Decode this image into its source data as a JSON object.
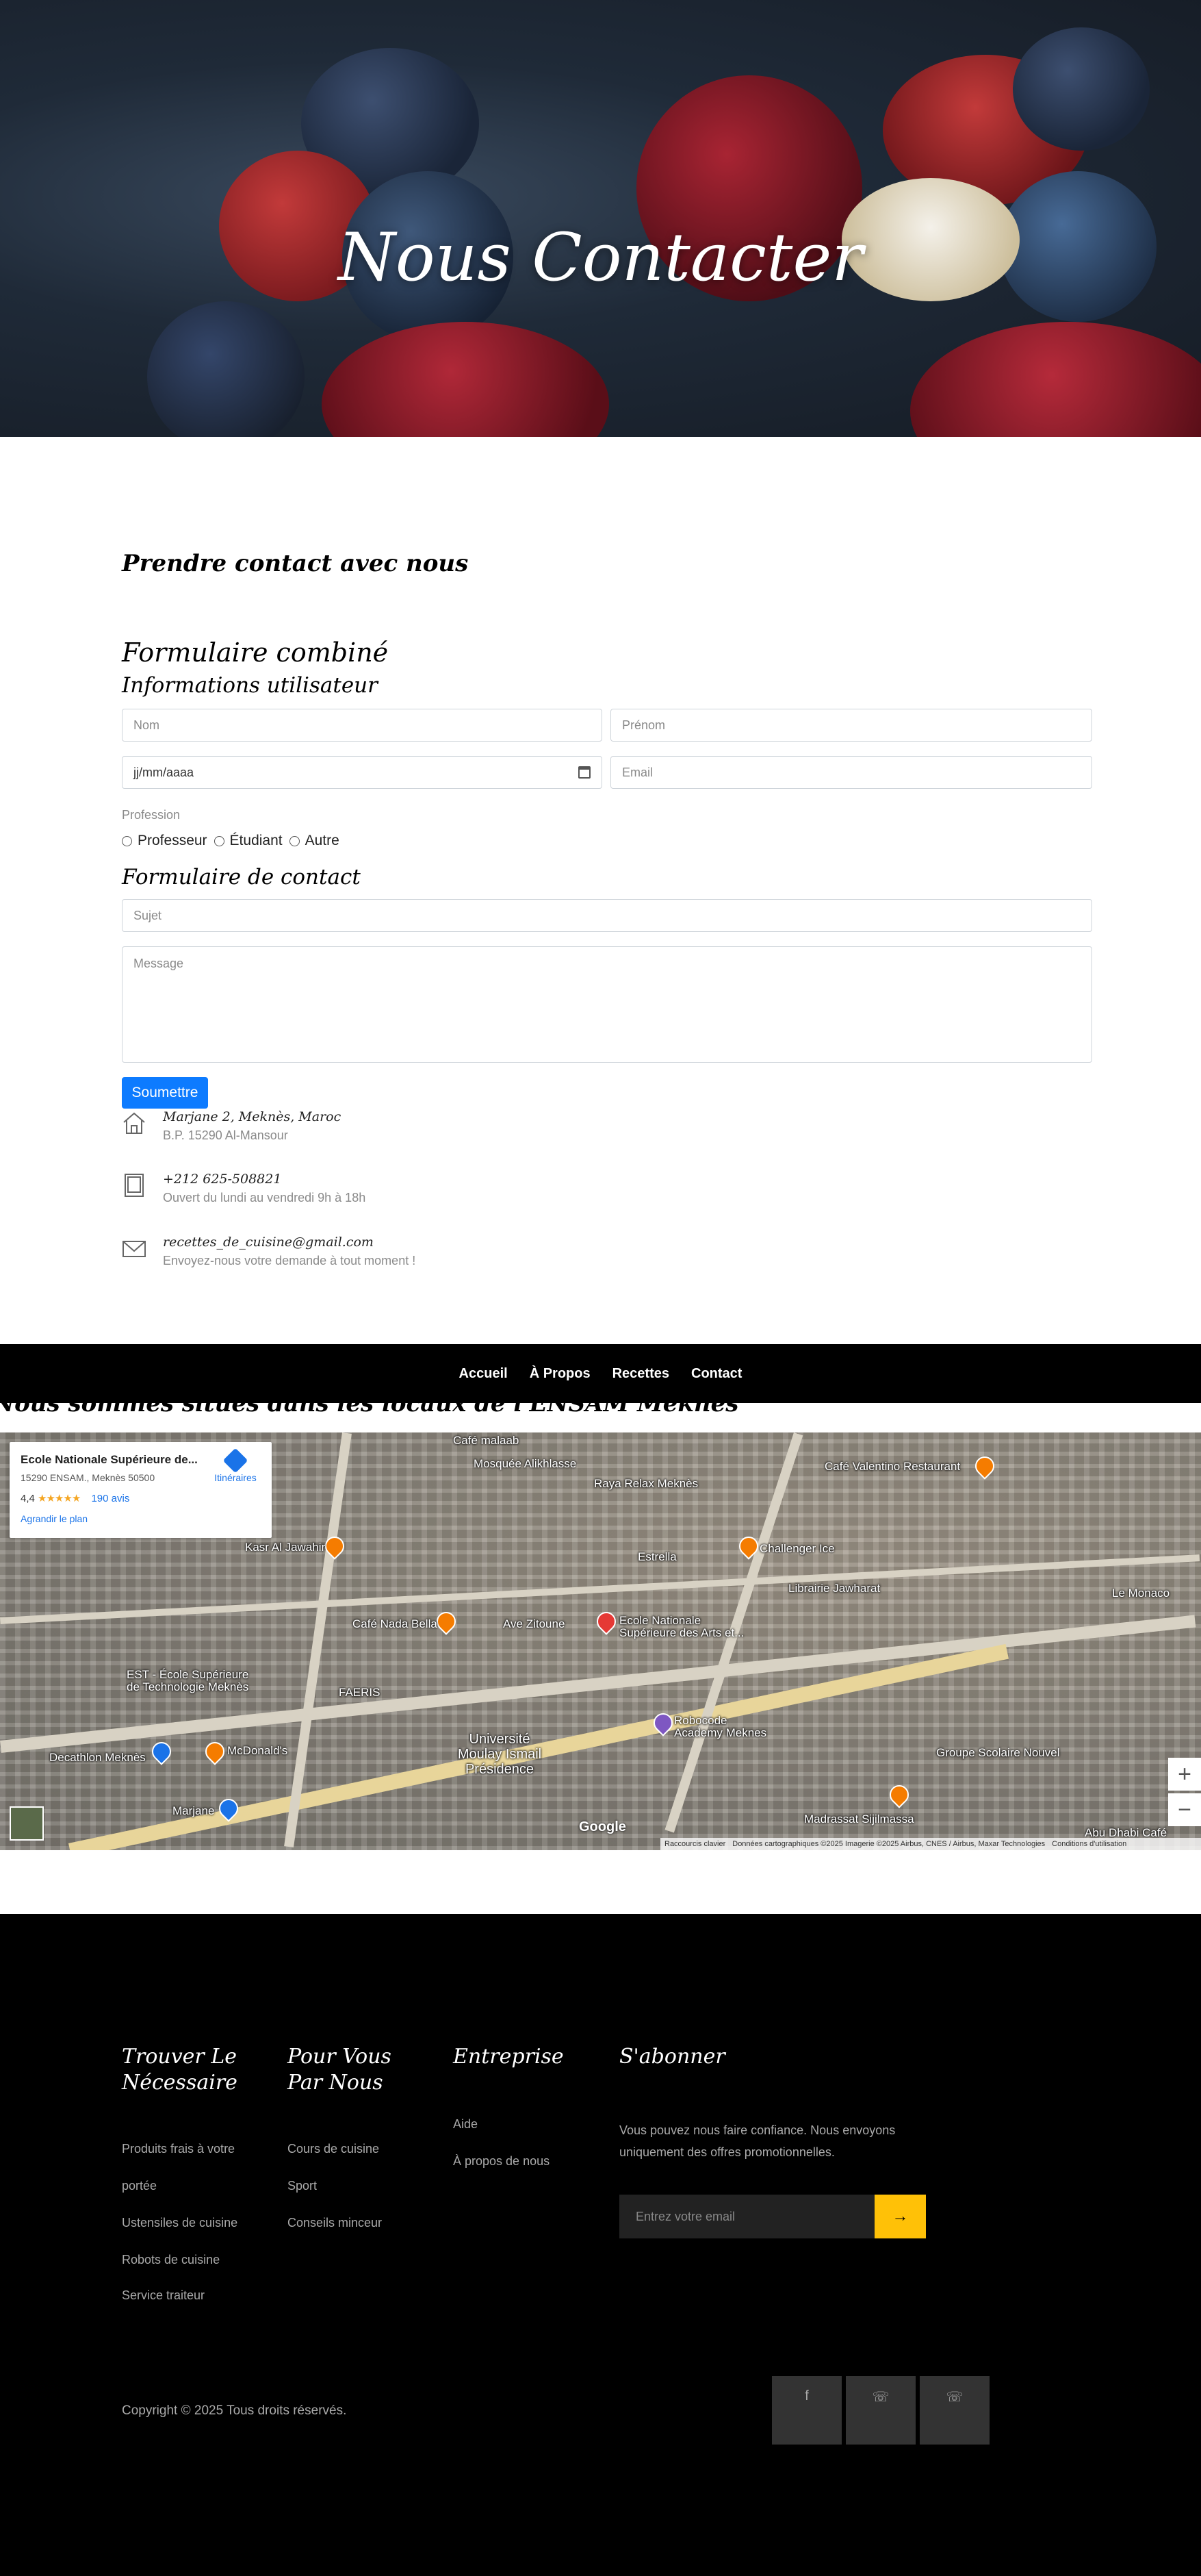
{
  "hero": {
    "title": "Nous Contacter"
  },
  "contact": {
    "lead_title": "Prendre contact avec nous",
    "form_title": "Formulaire combiné",
    "user_info_title": "Informations utilisateur",
    "fields": {
      "nom": "Nom",
      "prenom": "Prénom",
      "date": "jj/mm/aaaa",
      "email": "Email",
      "sujet": "Sujet",
      "message": "Message"
    },
    "profession_label": "Profession",
    "profession_options": [
      "Professeur",
      "Étudiant",
      "Autre"
    ],
    "contact_form_title": "Formulaire de contact",
    "submit_label": "Soumettre",
    "info": [
      {
        "icon": "home-icon",
        "line1": "Marjane 2, Meknès, Maroc",
        "line2": "B.P. 15290 Al-Mansour"
      },
      {
        "icon": "tablet-icon",
        "line1": "+212 625-508821",
        "line2": "Ouvert du lundi au vendredi 9h à 18h"
      },
      {
        "icon": "envelope-icon",
        "line1": "recettes_de_cuisine@gmail.com",
        "line2": "Envoyez-nous votre demande à tout moment !"
      }
    ]
  },
  "nav": {
    "items": [
      "Accueil",
      "À Propos",
      "Recettes",
      "Contact"
    ]
  },
  "clipped_heading": "Nous sommes situés dans les locaux de l'ENSAM Meknès",
  "map": {
    "place_name": "Ecole Nationale Supérieure de...",
    "address": "15290 ENSAM., Meknès 50500",
    "rating": "4,4",
    "stars": "★★★★★",
    "reviews": "190 avis",
    "enlarge": "Agrandir le plan",
    "directions": "Itinéraires",
    "labels": [
      "Mosquée Alikhlasse",
      "Raya Relax Meknès",
      "Café Valentino Restaurant",
      "Kasr Al Jawahir",
      "Estrella",
      "Challenger Ice",
      "Librairie Jawharat",
      "Le Monaco",
      "Café Nada Bella",
      "Ave Zitoune",
      "Ecole Nationale Supérieure des Arts et...",
      "EST - École Supérieure de Technologie Meknès",
      "FAERIS",
      "Decathlon Meknès",
      "McDonald's",
      "Université Moulay Ismail Présidence",
      "Robocode Academy Meknes",
      "Groupe Scolaire Nouvel",
      "Madrassat Sijilmassa",
      "Marjane",
      "Abu Dhabi Café",
      "Café malaab"
    ],
    "google": "Google",
    "footer_items": [
      "Raccourcis clavier",
      "Données cartographiques ©2025 Imagerie ©2025 Airbus, CNES / Airbus, Maxar Technologies",
      "Conditions d'utilisation"
    ],
    "zoom_in": "+",
    "zoom_out": "−"
  },
  "footer": {
    "col1": {
      "title": "Trouver Le Nécessaire",
      "links": [
        "Produits frais à votre",
        "portée",
        "Ustensiles de cuisine",
        "Robots de cuisine",
        "Service traiteur"
      ]
    },
    "col2": {
      "title": "Pour Vous Par Nous",
      "links": [
        "Cours de cuisine",
        "Sport",
        "Conseils minceur"
      ]
    },
    "col3": {
      "title": "Entreprise",
      "links": [
        "Aide",
        "À propos de nous"
      ]
    },
    "col4": {
      "title": "S'abonner",
      "desc": "Vous pouvez nous faire confiance. Nous envoyons uniquement des offres promotionnelles.",
      "placeholder": "Entrez votre email",
      "button": "→"
    },
    "copyright": "Copyright © 2025 Tous droits réservés.",
    "social": [
      "f",
      "☏",
      "☏"
    ]
  }
}
